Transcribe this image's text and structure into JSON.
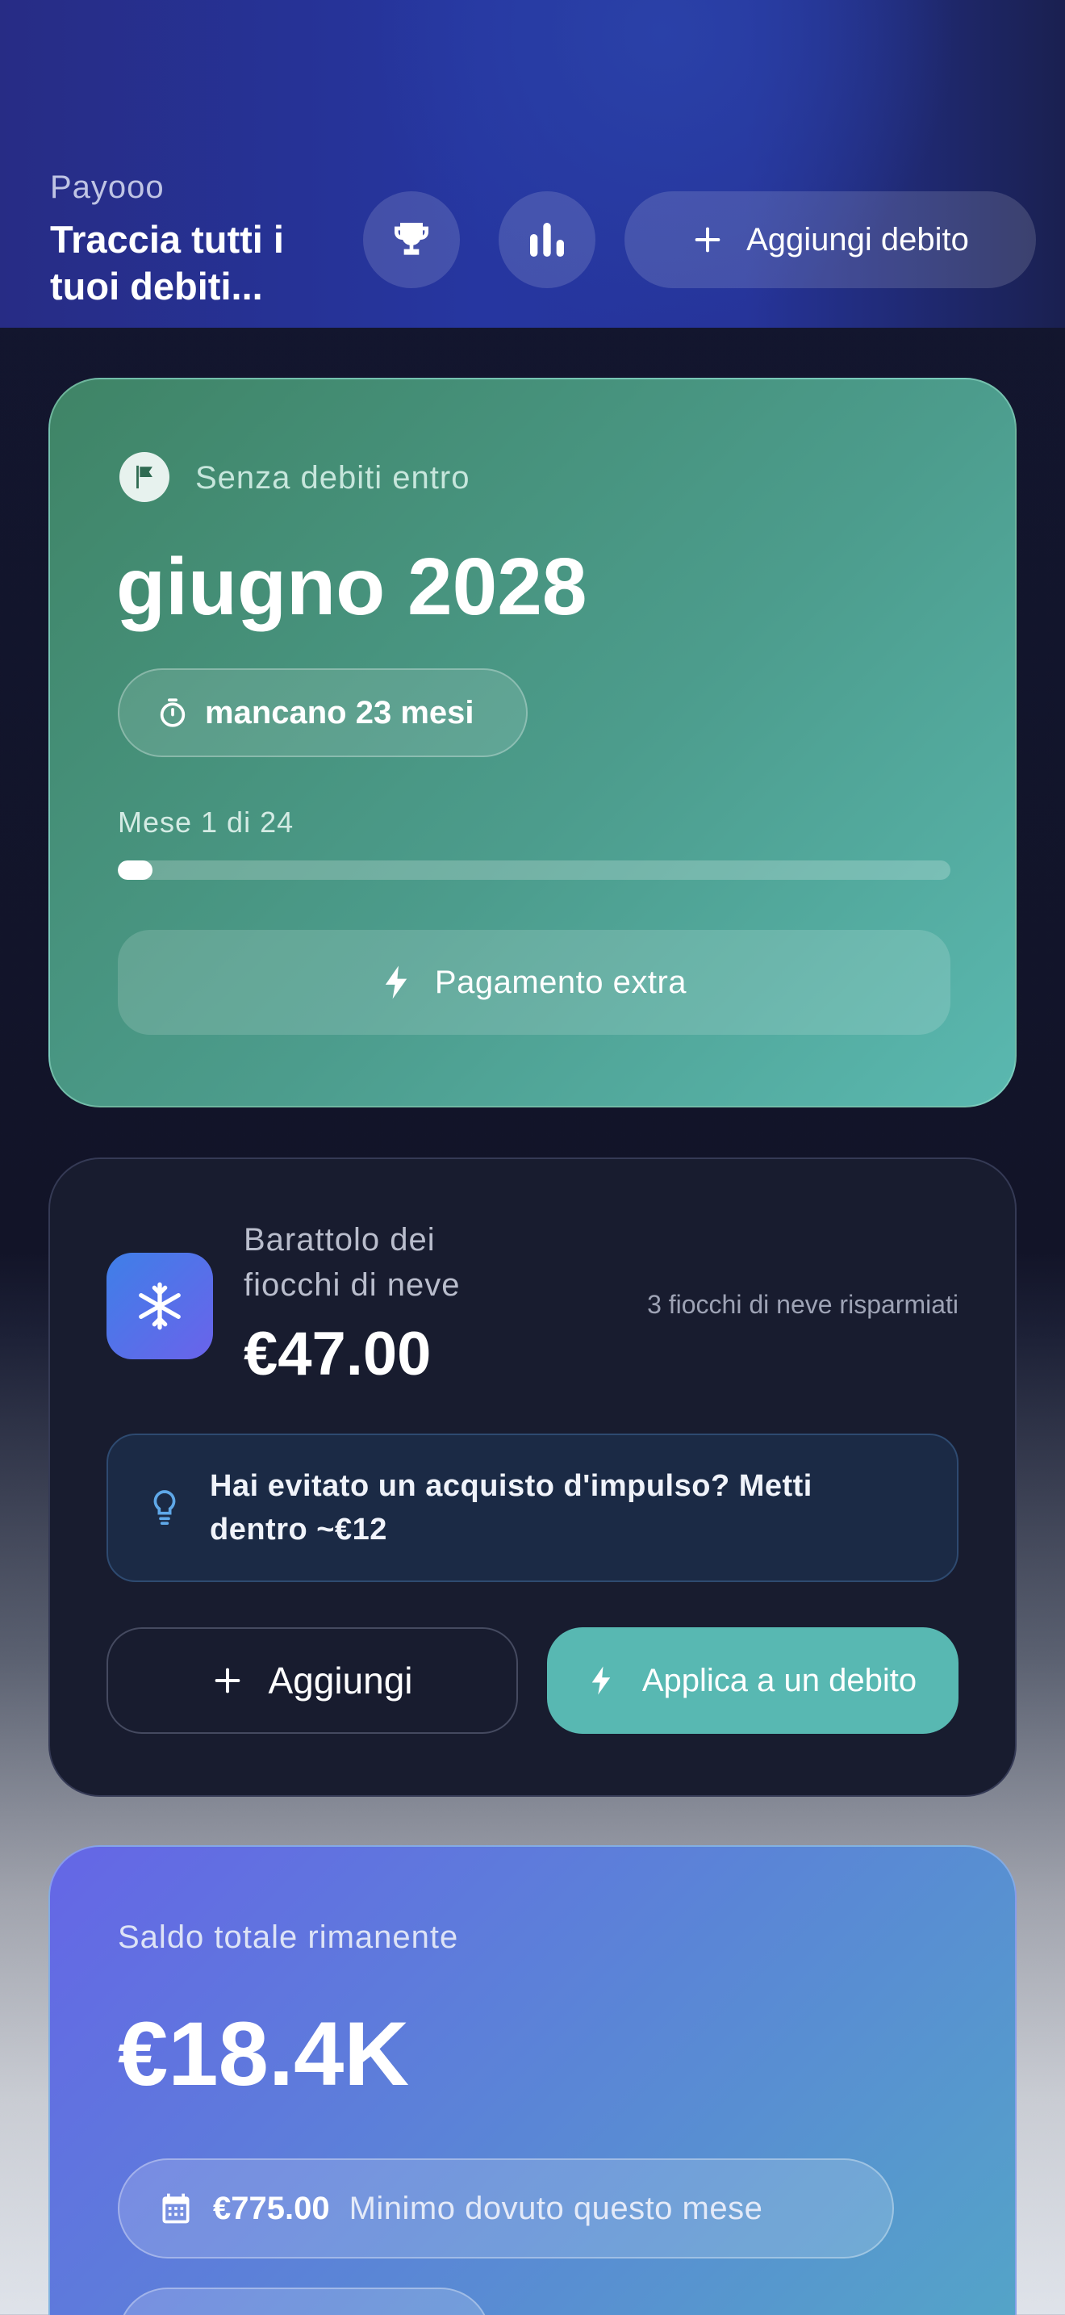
{
  "header": {
    "app_name": "Payooo",
    "tagline": "Traccia tutti i tuoi debiti...",
    "add_debt_label": "Aggiungi debito"
  },
  "debt_free_card": {
    "label": "Senza debiti entro",
    "date": "giugno 2028",
    "countdown": "mancano 23 mesi",
    "month_progress": "Mese 1 di 24",
    "progress_fraction": 0.042,
    "extra_payment_label": "Pagamento extra"
  },
  "snowflake_jar": {
    "title": "Barattolo dei fiocchi di neve",
    "amount": "€47.00",
    "saved_count": "3 fiocchi di neve risparmiati",
    "tip": "Hai evitato un acquisto d'impulso? Metti dentro ~€12",
    "add_label": "Aggiungi",
    "apply_label": "Applica a un debito"
  },
  "balance_card": {
    "label": "Saldo totale rimanente",
    "amount": "€18.4K",
    "minimum_amount": "€775.00",
    "minimum_label": "Minimo dovuto questo mese"
  },
  "colors": {
    "header_blue": "#2636a0",
    "green_card": "#4c9c8c",
    "teal_button": "#58b8b2",
    "dark_card": "#181c2f",
    "blue_card": "#5a86d6"
  }
}
